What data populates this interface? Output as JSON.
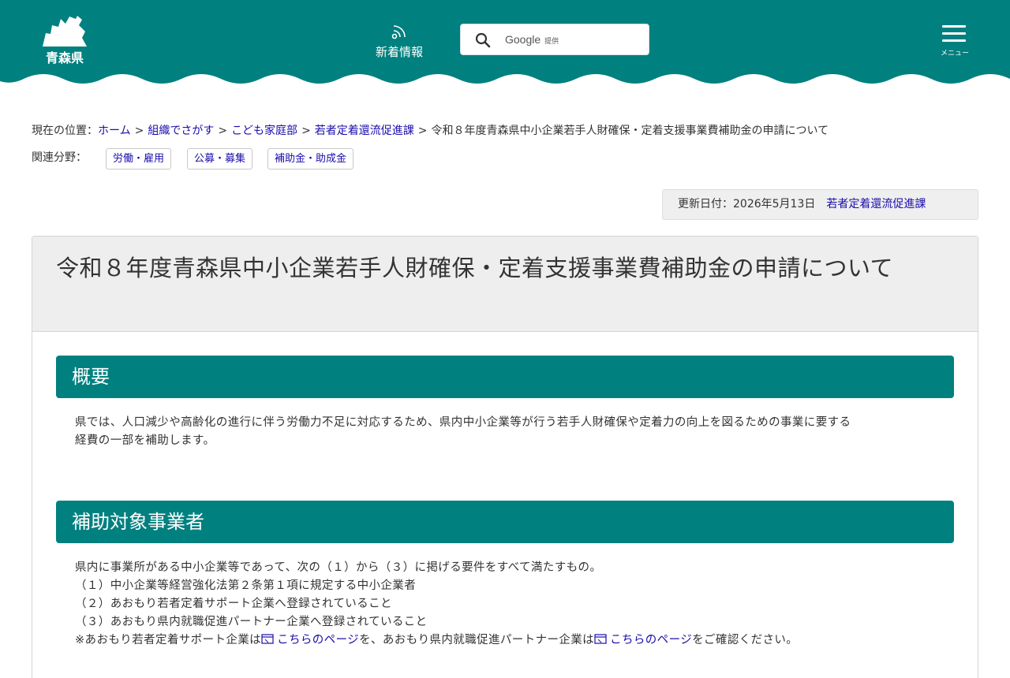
{
  "header": {
    "logo_text": "青森県",
    "news_label": "新着情報",
    "search_brand": "Google",
    "search_provided": "提供",
    "menu_label": "メニュー",
    "brand_color": "#00807f"
  },
  "breadcrumb": {
    "prefix": "現在の位置：",
    "links": [
      "ホーム",
      "組織でさがす",
      "こども家庭部",
      "若者定着還流促進課"
    ],
    "separator": ">",
    "current": "令和８年度青森県中小企業若手人財確保・定着支援事業費補助金の申請について"
  },
  "related": {
    "label": "関連分野：",
    "tags": [
      "労働・雇用",
      "公募・募集",
      "補助金・助成金"
    ]
  },
  "updated": {
    "text": "更新日付：2026年5月13日",
    "department": "若者定着還流促進課"
  },
  "article": {
    "title": "令和８年度青森県中小企業若手人財確保・定着支援事業費補助金の申請について",
    "sections": [
      {
        "heading": "概要",
        "lines": [
          "県では、人口減少や高齢化の進行に伴う労働力不足に対応するため、県内中小企業等が行う若手人財確保や定着力の向上を図るための事業に要する",
          "経費の一部を補助します。"
        ]
      },
      {
        "heading": "補助対象事業者",
        "lines": [
          "県内に事業所がある中小企業等であって、次の（１）から（３）に掲げる要件をすべて満たすもの。",
          "（１）中小企業等経営強化法第２条第１項に規定する中小企業者",
          "（２）あおもり若者定着サポート企業へ登録されていること",
          "（３）あおもり県内就職促進パートナー企業へ登録されていること"
        ],
        "note": {
          "part1": "※あおもり若者定着サポート企業は",
          "link1": "こちらのページ",
          "part2": "を、あおもり県内就職促進パートナー企業は",
          "link2": "こちらのページ",
          "part3": "をご確認ください。"
        }
      }
    ]
  }
}
